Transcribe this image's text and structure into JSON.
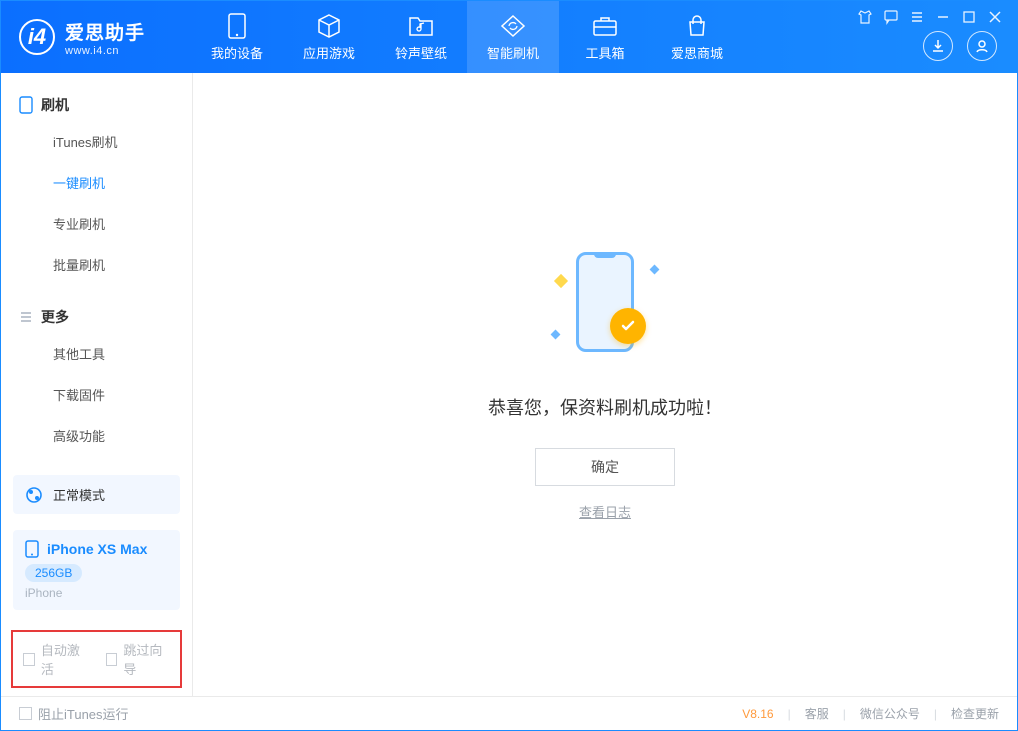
{
  "app": {
    "title": "爱思助手",
    "url": "www.i4.cn"
  },
  "nav": {
    "items": [
      {
        "label": "我的设备",
        "icon": "device"
      },
      {
        "label": "应用游戏",
        "icon": "cube"
      },
      {
        "label": "铃声壁纸",
        "icon": "music"
      },
      {
        "label": "智能刷机",
        "icon": "sync",
        "active": true
      },
      {
        "label": "工具箱",
        "icon": "toolbox"
      },
      {
        "label": "爱思商城",
        "icon": "store"
      }
    ]
  },
  "sidebar": {
    "section1": {
      "title": "刷机",
      "items": [
        {
          "label": "iTunes刷机"
        },
        {
          "label": "一键刷机",
          "active": true
        },
        {
          "label": "专业刷机"
        },
        {
          "label": "批量刷机"
        }
      ]
    },
    "section2": {
      "title": "更多",
      "items": [
        {
          "label": "其他工具"
        },
        {
          "label": "下载固件"
        },
        {
          "label": "高级功能"
        }
      ]
    },
    "mode": {
      "label": "正常模式"
    },
    "device": {
      "name": "iPhone XS Max",
      "storage": "256GB",
      "type": "iPhone"
    },
    "checks": {
      "auto_activate": "自动激活",
      "skip_guide": "跳过向导"
    }
  },
  "main": {
    "success": "恭喜您，保资料刷机成功啦！",
    "ok": "确定",
    "log": "查看日志"
  },
  "footer": {
    "block_itunes": "阻止iTunes运行",
    "version": "V8.16",
    "links": [
      "客服",
      "微信公众号",
      "检查更新"
    ]
  }
}
